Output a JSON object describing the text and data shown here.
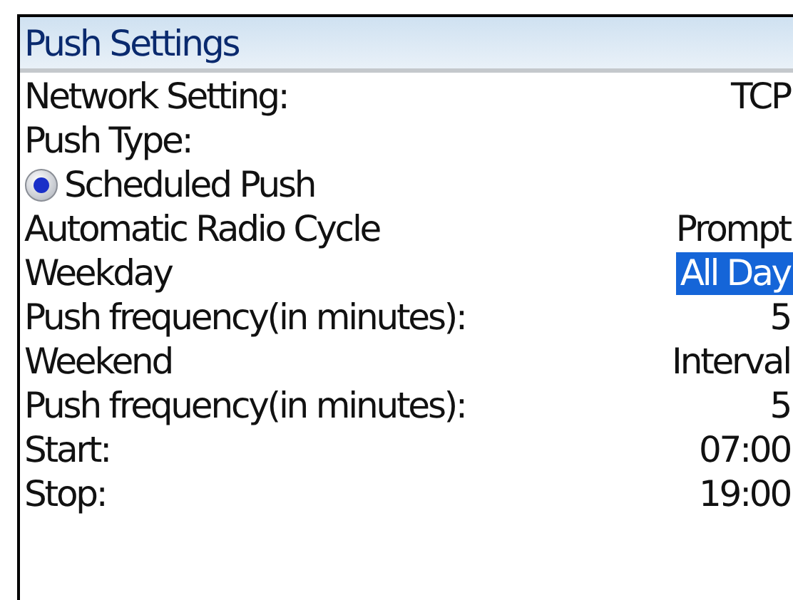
{
  "screen": {
    "title": "Push Settings"
  },
  "rows": [
    {
      "kind": "setting",
      "label": "Network Setting:",
      "value": "TCP",
      "selected": false
    },
    {
      "kind": "heading",
      "label": "Push Type:"
    },
    {
      "kind": "radio",
      "label": "Scheduled Push",
      "selected": true
    },
    {
      "kind": "setting",
      "label": "Automatic Radio Cycle",
      "value": "Prompt",
      "selected": false
    },
    {
      "kind": "setting",
      "label": "Weekday",
      "value": "All Day",
      "selected": true
    },
    {
      "kind": "setting",
      "label": "Push frequency(in minutes):",
      "value": "5",
      "selected": false
    },
    {
      "kind": "setting",
      "label": "Weekend",
      "value": "Interval",
      "selected": false
    },
    {
      "kind": "setting",
      "label": "Push frequency(in minutes):",
      "value": "5",
      "selected": false
    },
    {
      "kind": "setting",
      "label": "Start:",
      "value": "07:00",
      "selected": false
    },
    {
      "kind": "setting",
      "label": "Stop:",
      "value": "19:00",
      "selected": false
    }
  ]
}
